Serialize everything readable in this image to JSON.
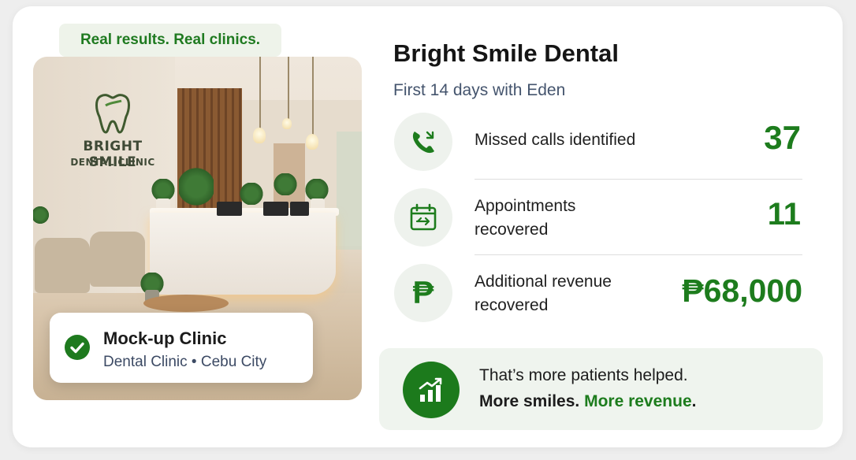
{
  "tagline": "Real results. Real clinics.",
  "photo": {
    "sign_line1": "BRIGHT SMILE",
    "sign_line2": "DENTAL CLINIC"
  },
  "clinic_card": {
    "name": "Mock-up Clinic",
    "subtitle": "Dental Clinic • Cebu City",
    "icon": "check-circle-icon"
  },
  "header": {
    "title": "Bright Smile Dental",
    "subtitle": "First 14 days with Eden"
  },
  "stats": [
    {
      "icon": "phone-missed-icon",
      "label": "Missed calls identified",
      "value": "37"
    },
    {
      "icon": "calendar-icon",
      "label": "Appointments recovered",
      "value": "11"
    },
    {
      "icon": "peso-icon",
      "label": "Additional revenue recovered",
      "value": "₱68,000"
    }
  ],
  "banner": {
    "icon": "chart-growth-icon",
    "line1": "That’s more patients helped.",
    "line2_prefix": "More smiles.",
    "line2_accent": "More revenue",
    "line2_suffix": "."
  },
  "colors": {
    "accent_green": "#1d7c1d",
    "tag_bg": "#eef3ea",
    "icon_bg": "#eef2ed",
    "subtitle_blue": "#44546d"
  }
}
